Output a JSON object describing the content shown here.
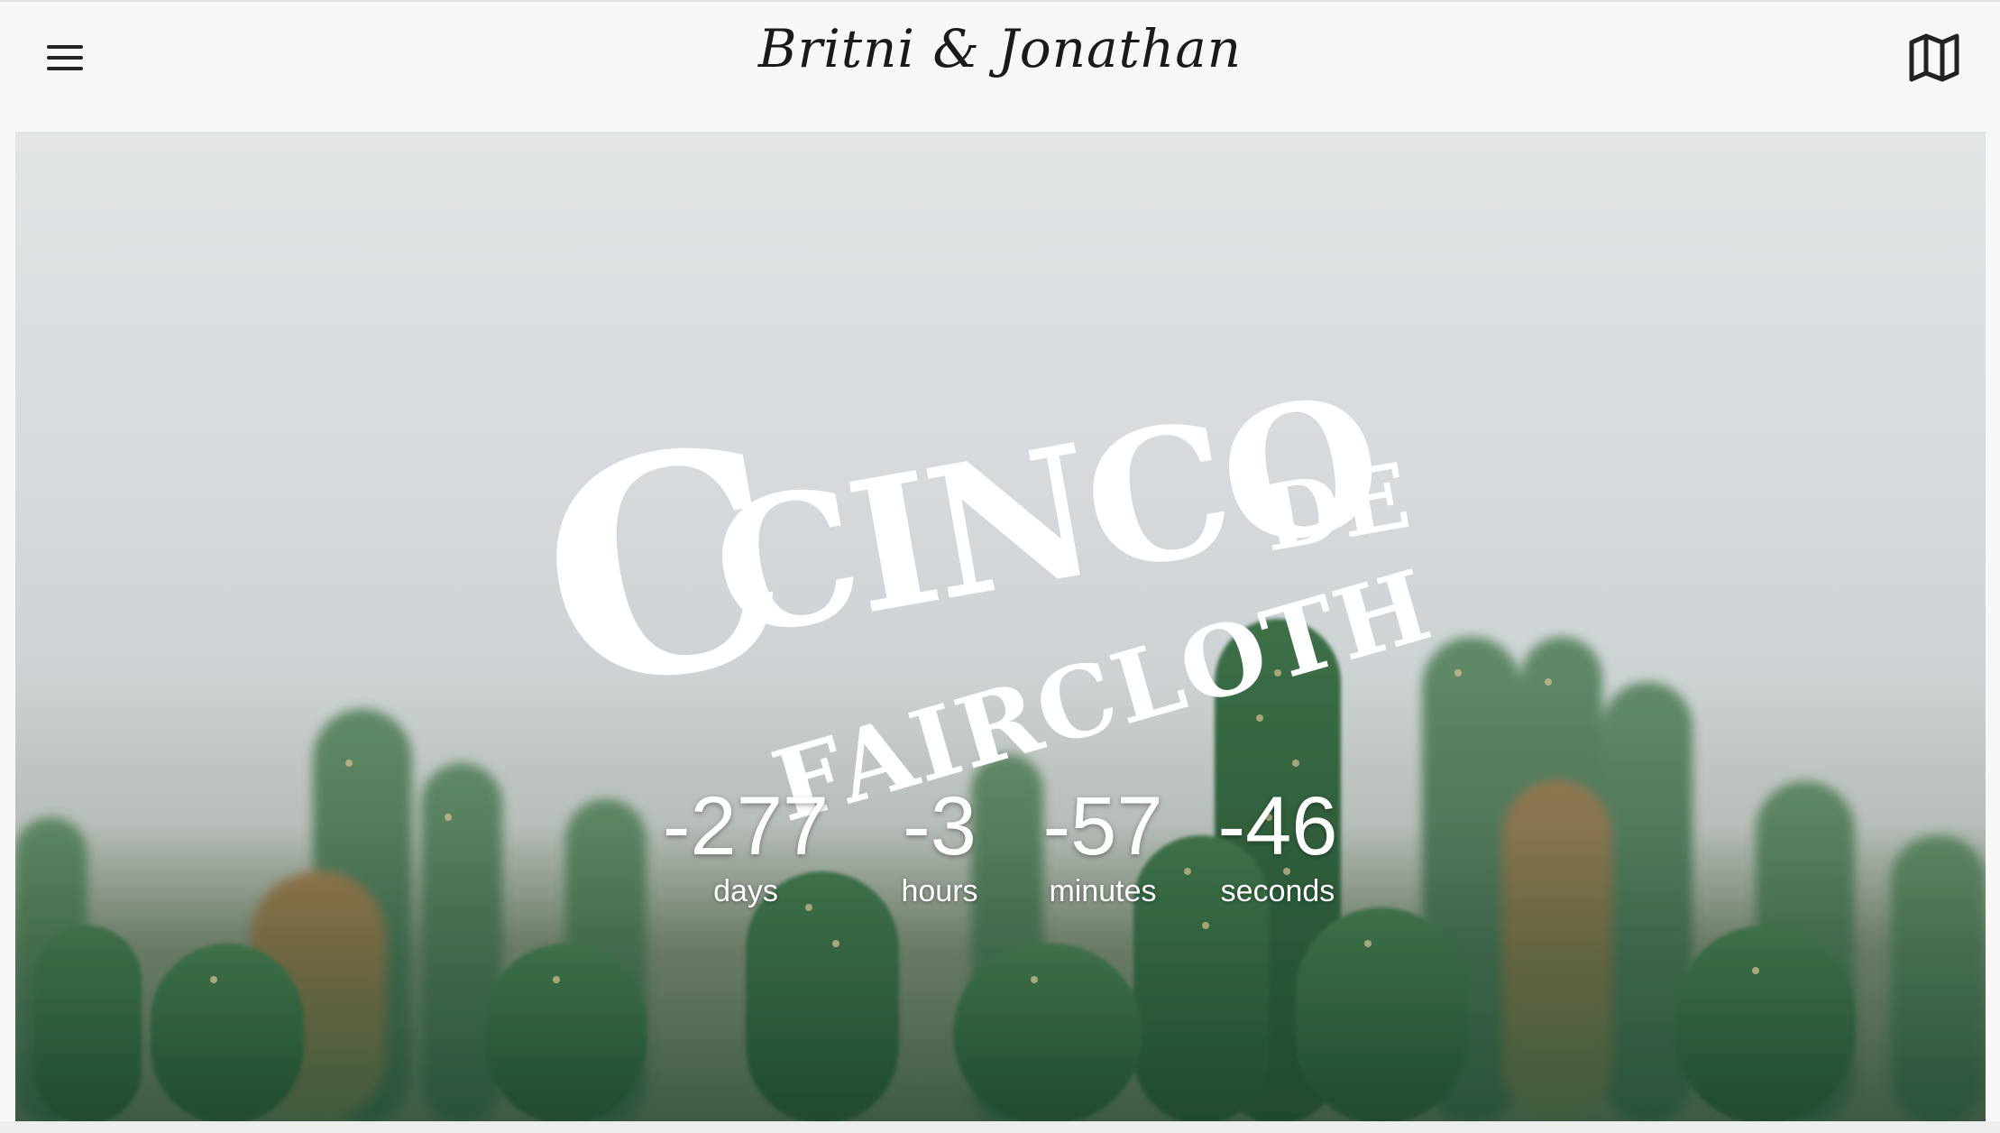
{
  "header": {
    "title": "Britni & Jonathan",
    "menu_icon": "hamburger-menu-icon",
    "map_icon": "map-icon"
  },
  "hero": {
    "headline_line1": "CINCO",
    "headline_de": "DE",
    "headline_line2": "FAIRCLOTH",
    "countdown": [
      {
        "value": "-277",
        "label": "days"
      },
      {
        "value": "-3",
        "label": "hours"
      },
      {
        "value": "-57",
        "label": "minutes"
      },
      {
        "value": "-46",
        "label": "seconds"
      }
    ]
  },
  "colors": {
    "header_bg": "#f8f8f8",
    "text_dark": "#1a1a1a",
    "hero_text": "#ffffff",
    "cactus_green": "#2f5e3d"
  }
}
